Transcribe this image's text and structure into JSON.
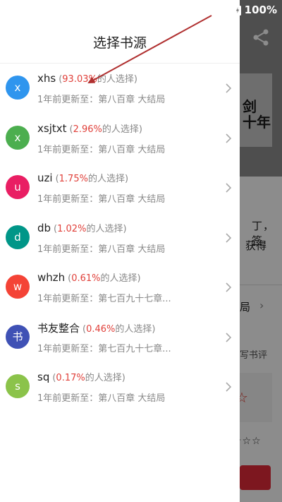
{
  "status_bar": {
    "battery": "100%"
  },
  "background": {
    "cover_text": "剑\n十年",
    "text_line1": "丁，签",
    "text_line2": "获得",
    "row_label": "局",
    "review_label": "写书评",
    "rating_stars": "☆☆☆"
  },
  "drawer": {
    "title": "选择书源",
    "sources": [
      {
        "name": "xhs",
        "avatar_char": "x",
        "color": "#2f95ee",
        "pct": "93.03%",
        "suffix": "的人选择)",
        "update": "1年前更新至：第八百章 大结局"
      },
      {
        "name": "xsjtxt",
        "avatar_char": "x",
        "color": "#4cae4f",
        "pct": "2.96%",
        "suffix": "的人选择)",
        "update": "1年前更新至：第八百章 大结局"
      },
      {
        "name": "uzi",
        "avatar_char": "u",
        "color": "#e91e63",
        "pct": "1.75%",
        "suffix": "的人选择)",
        "update": "1年前更新至：第八百章 大结局"
      },
      {
        "name": "db",
        "avatar_char": "d",
        "color": "#009688",
        "pct": "1.02%",
        "suffix": "的人选择)",
        "update": "1年前更新至：第八百章 大结局"
      },
      {
        "name": "whzh",
        "avatar_char": "w",
        "color": "#f44336",
        "pct": "0.61%",
        "suffix": "的人选择)",
        "update": "1年前更新至：第七百九十七章..."
      },
      {
        "name": "书友整合",
        "avatar_char": "书",
        "color": "#3f51b5",
        "pct": "0.46%",
        "suffix": "的人选择)",
        "update": "1年前更新至：第七百九十七章..."
      },
      {
        "name": "sq",
        "avatar_char": "s",
        "color": "#8bc34a",
        "pct": "0.17%",
        "suffix": "的人选择)",
        "update": "1年前更新至：第八百章 大结局"
      }
    ]
  },
  "annotation": {
    "arrow_color": "#b03030"
  }
}
